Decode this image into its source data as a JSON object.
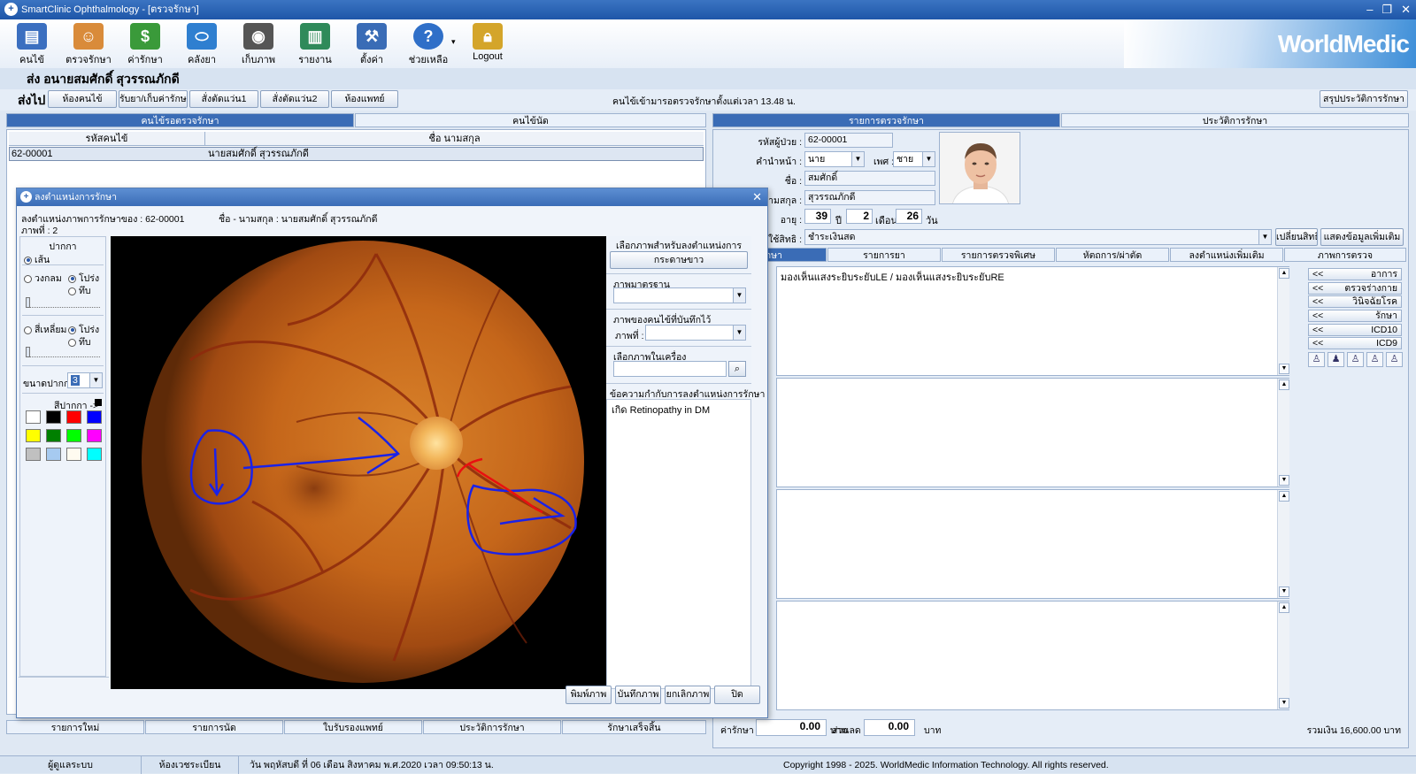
{
  "window": {
    "title": "SmartClinic Ophthalmology - [ตรวจรักษา]",
    "min": "–",
    "max": "❐",
    "close": "✕"
  },
  "toolbar": {
    "items": [
      {
        "label": "คนไข้",
        "color": "#3b6fc0",
        "icon": "patient-book-icon"
      },
      {
        "label": "ตรวจรักษา",
        "color": "#d98b3a",
        "icon": "doctor-icon"
      },
      {
        "label": "ค่ารักษา",
        "color": "#3a9a3a",
        "icon": "money-icon"
      },
      {
        "label": "คลังยา",
        "color": "#2f7fd0",
        "icon": "pill-icon"
      },
      {
        "label": "เก็บภาพ",
        "color": "#555555",
        "icon": "camera-icon"
      },
      {
        "label": "รายงาน",
        "color": "#2f8a5a",
        "icon": "chart-icon"
      },
      {
        "label": "ตั้งค่า",
        "color": "#3a6cb6",
        "icon": "tools-icon"
      },
      {
        "label": "ช่วยเหลือ",
        "color": "#2f6fc8",
        "icon": "help-icon"
      },
      {
        "label": "Logout",
        "color": "#d4a52a",
        "icon": "lock-icon"
      }
    ],
    "help_caret": "▾",
    "watermark": "WorldMedic"
  },
  "patient_header": "ส่ง  อนายสมศักดิ์ สุวรรณภักดี",
  "send_bar": {
    "label": "ส่งไป",
    "buttons": [
      "ห้องคนไข้",
      "รับยา/เก็บค่ารักษา",
      "สั่งตัดแว่น1",
      "สั่งตัดแว่น2",
      "ห้องแพทย์"
    ],
    "waiting_text": "คนไข้เข้ามารอตรวจรักษาตั้งแต่เวลา 13.48 น.",
    "summary_button": "สรุปประวัติการรักษา"
  },
  "left_tabs": [
    "คนไข้รอตรวจรักษา",
    "คนไข้นัด"
  ],
  "patient_table": {
    "headers": [
      "รหัสคนไข้",
      "ชื่อ นามสกุล"
    ],
    "rows": [
      {
        "id": "62-00001",
        "name": "นายสมศักดิ์ สุวรรณภักดี"
      }
    ]
  },
  "bottom_tabs": [
    "รายการใหม่",
    "รายการนัด",
    "ใบรับรองแพทย์",
    "ประวัติการรักษา",
    "รักษาเสร็จสิ้น"
  ],
  "right_tabs": [
    "รายการตรวจรักษา",
    "ประวัติการรักษา"
  ],
  "patient_info": {
    "code_label": "รหัสผู้ป่วย :",
    "code": "62-00001",
    "prefix_label": "คำนำหน้า :",
    "prefix": "นาย",
    "sex_label": "เพศ :",
    "sex": "ชาย",
    "name_label": "ชื่อ :",
    "name": "สมศักดิ์",
    "surname_label": "นามสกุล :",
    "surname": "สุวรรณภักดี",
    "age_label": "อายุ :",
    "age_years": "39",
    "years_unit": "ปี",
    "age_months": "2",
    "months_unit": "เดือน",
    "age_days": "26",
    "days_unit": "วัน",
    "right_label": "ใช้สิทธิ :",
    "right_value": "ชำระเงินสด",
    "change_right_button": "เปลี่ยนสิทธิ",
    "more_info_button": "แสดงข้อมูลเพิ่มเติม"
  },
  "exam_tabs": [
    "รักษา",
    "รายการยา",
    "รายการตรวจพิเศษ",
    "หัตถการ/ผ่าตัด",
    "ลงตำแหน่งเพิ่มเติม",
    "ภาพการตรวจ"
  ],
  "exam_text": "มองเห็นแสงระยิบระยับLE / มองเห็นแสงระยิบระยับRE",
  "side_buttons": [
    {
      "arrow": "<<",
      "label": "อาการ"
    },
    {
      "arrow": "<<",
      "label": "ตรวจร่างกาย"
    },
    {
      "arrow": "<<",
      "label": "วินิจฉัยโรค"
    },
    {
      "arrow": "<<",
      "label": "รักษา"
    },
    {
      "arrow": "<<",
      "label": "ICD10"
    },
    {
      "arrow": "<<",
      "label": "ICD9"
    }
  ],
  "totals": {
    "fee_label": "ค่ารักษา :",
    "fee": "0.00",
    "fee_unit": "บาท",
    "discount_label": "ส่วนลด :",
    "discount": "0.00",
    "discount_unit": "บาท",
    "total": "รวมเงิน 16,600.00 บาท"
  },
  "dialog": {
    "title": "ลงตำแหน่งการรักษา",
    "close": "✕",
    "info_line1": "ลงตำแหน่งภาพการรักษาของ : 62-00001",
    "info_name": "ชื่อ - นามสกุล : นายสมศักดิ์ สุวรรณภักดี",
    "info_line2": "ภาพที่ : 2",
    "pen_group": "ปากกา",
    "pen_line": "เส้น",
    "circle": "วงกลม",
    "circle_transparent": "โปร่ง",
    "circle_solid": "ทึบ",
    "rect": "สี่เหลี่ยม",
    "rect_transparent": "โปร่ง",
    "rect_solid": "ทึบ",
    "pen_size_label": "ขนาดปากกา",
    "pen_size": "3",
    "pen_color_label": "สีปากกา ->",
    "palette": [
      "#ffffff",
      "#000000",
      "#ff0000",
      "#0000ff",
      "#ffff00",
      "#008000",
      "#00ff00",
      "#ff00ff",
      "#c0c0c0",
      "#a6caf0",
      "#fffbf0",
      "#00ffff"
    ],
    "select_image_label": "เลือกภาพสำหรับลงตำแหน่งการรักษา",
    "white_paper_button": "กระดาษขาว",
    "standard_image_label": "ภาพมาตรฐาน",
    "saved_image_label": "ภาพของคนไข้ที่บันทึกไว้",
    "image_no_label": "ภาพที่ :",
    "local_image_label": "เลือกภาพในเครื่อง",
    "note_label": "ข้อความกำกับการลงตำแหน่งการรักษา",
    "note_text": "เกิด Retinopathy in DM",
    "buttons": [
      "พิมพ์ภาพ",
      "บันทึกภาพ",
      "ยกเลิกภาพ",
      "ปิด"
    ]
  },
  "status": {
    "user": "ผู้ดูแลระบบ",
    "room": "ห้องเวชระเบียน",
    "datetime": "วัน พฤหัสบดี ที่ 06 เดือน สิงหาคม พ.ศ.2020 เวลา 09:50:13 น.",
    "copyright": "Copyright 1998 - 2025. WorldMedic Information Technology. All rights reserved."
  }
}
